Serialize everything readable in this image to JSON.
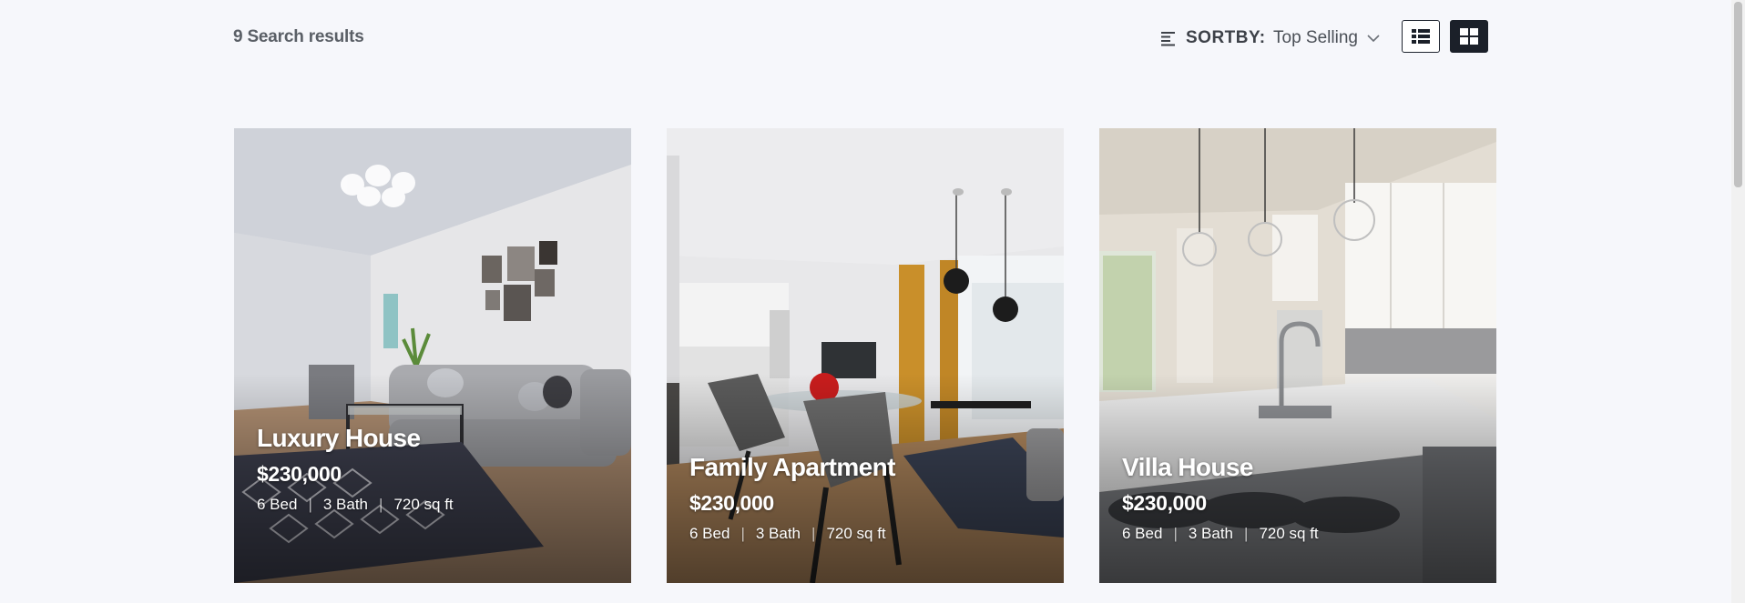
{
  "results": {
    "text": "9 Search results"
  },
  "sort": {
    "label": "SORTBY:",
    "selected": "Top Selling",
    "icon": "sort-lines-icon",
    "chevron_icon": "chevron-down-icon"
  },
  "view_toggle": {
    "list_icon": "list-view-icon",
    "grid_icon": "grid-view-icon",
    "active": "grid"
  },
  "listings": [
    {
      "title": "Luxury House",
      "price": "$230,000",
      "beds": "6 Bed",
      "baths": "3 Bath",
      "area": "720 sq ft"
    },
    {
      "title": "Family Apartment",
      "price": "$230,000",
      "beds": "6 Bed",
      "baths": "3 Bath",
      "area": "720 sq ft"
    },
    {
      "title": "Villa House",
      "price": "$230,000",
      "beds": "6 Bed",
      "baths": "3 Bath",
      "area": "720 sq ft"
    }
  ],
  "colors": {
    "page_bg": "#f6f7fb",
    "text_dark": "#3b3f46",
    "button_dark": "#1b2029"
  }
}
